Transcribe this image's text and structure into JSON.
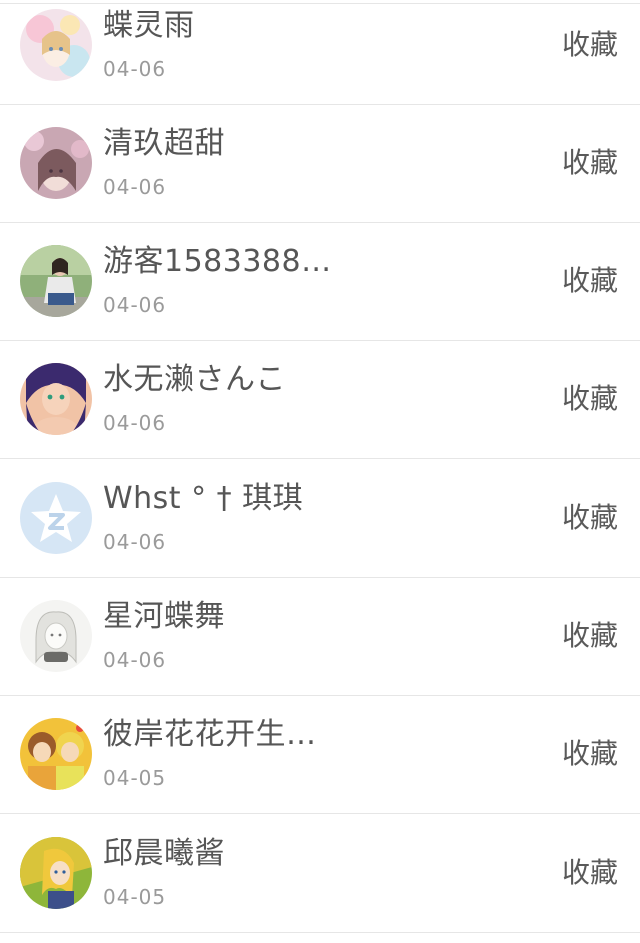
{
  "list": {
    "items": [
      {
        "name": "蝶灵雨",
        "date": "04-06",
        "action": "收藏",
        "avatar": "anime-girl-pastel-avatar"
      },
      {
        "name": "清玖超甜",
        "date": "04-06",
        "action": "收藏",
        "avatar": "anime-girl-pink-avatar"
      },
      {
        "name": "游客1583388…",
        "date": "04-06",
        "action": "收藏",
        "avatar": "photo-girl-outdoor-avatar"
      },
      {
        "name": "水无濑さんこ",
        "date": "04-06",
        "action": "收藏",
        "avatar": "anime-girl-purple-hair-avatar"
      },
      {
        "name": "Whst ° † 琪琪",
        "date": "04-06",
        "action": "收藏",
        "avatar": "qzone-star-default-avatar"
      },
      {
        "name": "星河蝶舞",
        "date": "04-06",
        "action": "收藏",
        "avatar": "sketch-girl-avatar"
      },
      {
        "name": "彼岸花花开生…",
        "date": "04-05",
        "action": "收藏",
        "avatar": "anime-characters-yellow-avatar"
      },
      {
        "name": "邱晨曦酱",
        "date": "04-05",
        "action": "收藏",
        "avatar": "anime-girl-yellow-avatar"
      }
    ]
  },
  "colors": {
    "divider": "#e6e6e6",
    "name_text": "#565656",
    "date_text": "#9a9a9a",
    "action_text": "#5a5a5a",
    "qzone_star_bg": "#d6e6f5"
  }
}
